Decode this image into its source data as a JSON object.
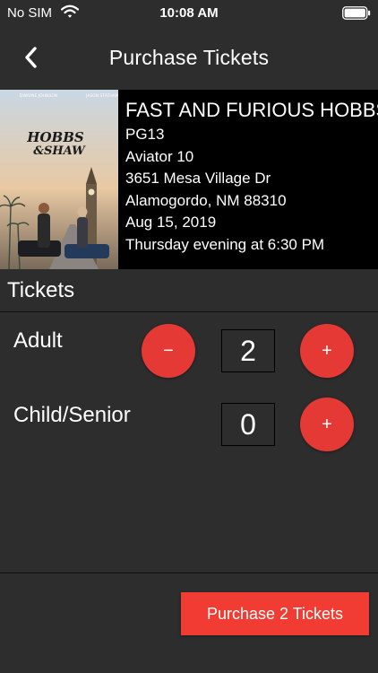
{
  "status_bar": {
    "carrier": "No SIM",
    "time": "10:08 AM"
  },
  "nav": {
    "title": "Purchase Tickets",
    "back_icon": "chevron-left-icon"
  },
  "movie": {
    "poster_icon": "movie-poster",
    "title": "FAST AND FURIOUS HOBBS & SHAW",
    "rating": "PG13",
    "theater": "Aviator 10",
    "address1": "3651 Mesa Village Dr",
    "address2": "Alamogordo, NM 88310",
    "date": "Aug 15, 2019",
    "showtime": "Thursday evening at 6:30 PM"
  },
  "tickets": {
    "section_label": "Tickets",
    "types": [
      {
        "label": "Adult",
        "quantity": "2",
        "decrement_label": "−",
        "increment_label": "+"
      },
      {
        "label": "Child/Senior",
        "quantity": "0",
        "increment_label": "+"
      }
    ]
  },
  "purchase": {
    "label": "Purchase 2 Tickets"
  },
  "colors": {
    "background": "#2d2d2d",
    "accent": "#e53935",
    "purchase_button": "#f03c32"
  }
}
